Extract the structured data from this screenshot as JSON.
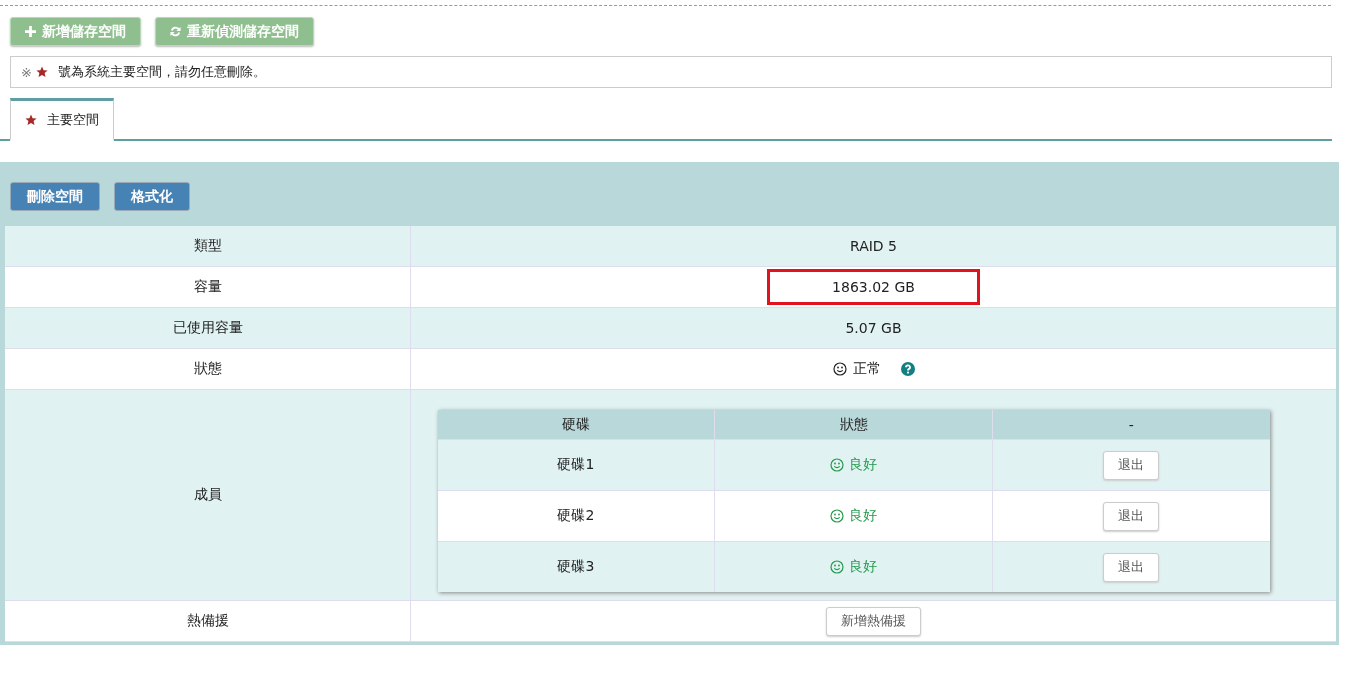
{
  "toolbar": {
    "buttons": [
      {
        "label": "新增儲存空間"
      },
      {
        "label": "重新偵測儲存空間"
      }
    ]
  },
  "notice": {
    "prefix": "※",
    "text": "號為系統主要空間，請勿任意刪除。"
  },
  "tabs": [
    {
      "label": "主要空間",
      "selected": true
    }
  ],
  "panel": {
    "buttons": [
      "刪除空間",
      "格式化"
    ],
    "rows": [
      {
        "kind": "text",
        "label": "類型",
        "value": "RAID 5"
      },
      {
        "kind": "text",
        "label": "容量",
        "value": "1863.02 GB",
        "highlighted": true
      },
      {
        "kind": "text",
        "label": "已使用容量",
        "value": "5.07 GB"
      },
      {
        "kind": "status",
        "label": "狀態",
        "value": "正常"
      },
      {
        "kind": "members",
        "label": "成員",
        "columns": [
          "硬碟",
          "狀態",
          "-"
        ],
        "disks": [
          {
            "name": "硬碟1",
            "status": "良好",
            "action": "退出"
          },
          {
            "name": "硬碟2",
            "status": "良好",
            "action": "退出"
          },
          {
            "name": "硬碟3",
            "status": "良好",
            "action": "退出"
          }
        ]
      },
      {
        "kind": "button",
        "label": "熱備援",
        "value": "新增熱備援"
      }
    ]
  }
}
